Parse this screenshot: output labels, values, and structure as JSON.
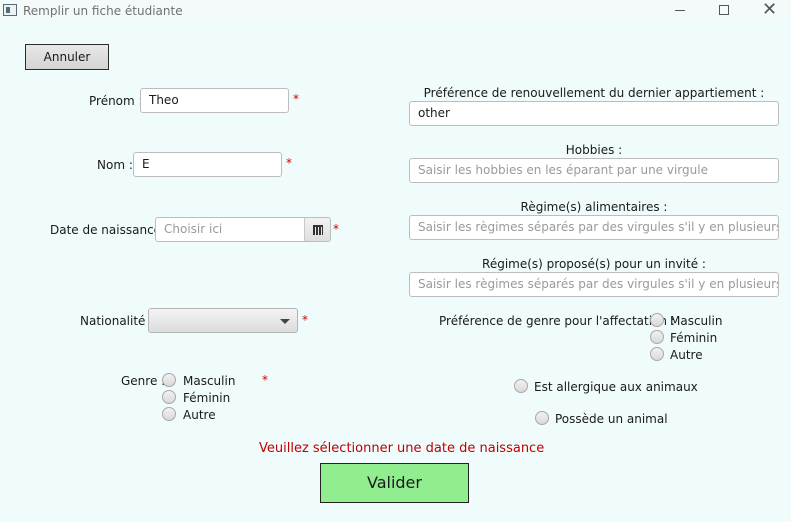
{
  "window": {
    "title": "Remplir un fiche étudiante",
    "controls": [
      "minimize-icon",
      "maximize-icon",
      "close-icon"
    ],
    "close_glyph": "✕"
  },
  "buttons": {
    "cancel": "Annuler",
    "submit": "Valider"
  },
  "form": {
    "prenom": {
      "label": "Prénom :",
      "value": "Theo",
      "required": "*"
    },
    "nom": {
      "label": "Nom :",
      "value": "E",
      "required": "*"
    },
    "date_naissance": {
      "label": "Date de naissance :",
      "placeholder": "Choisir ici",
      "required": "*",
      "icon": "calendar-icon"
    },
    "nationalite": {
      "label": "Nationalité :",
      "value": "",
      "required": "*"
    },
    "genre": {
      "label": "Genre :",
      "required": "*",
      "options": [
        "Masculin",
        "Féminin",
        "Autre"
      ]
    },
    "renouvellement": {
      "label": "Préférence de renouvellement du dernier appartiement :",
      "value": "other"
    },
    "hobbies": {
      "label": "Hobbies :",
      "placeholder": "Saisir les hobbies en les éparant par une virgule"
    },
    "regimes": {
      "label": "Règime(s) alimentaires :",
      "placeholder": "Saisir les règimes séparés par des virgules s'il y en plusieurs"
    },
    "regimes_invite": {
      "label": "Régime(s) proposé(s) pour un invité :",
      "placeholder": "Saisir les règimes séparés par des virgules s'il y en plusieurs"
    },
    "genre_affectation": {
      "label": "Préférence de genre pour l'affectation :",
      "options": [
        "Masculin",
        "Féminin",
        "Autre"
      ]
    },
    "allergique": {
      "label": "Est allergique aux animaux"
    },
    "possede_animal": {
      "label": "Possède un animal"
    }
  },
  "error_message": "Veuillez sélectionner une date de naissance",
  "colors": {
    "background": "#f0fbfb",
    "required": "#d00000",
    "error": "#c00000",
    "submit_bg": "#90ee90"
  }
}
